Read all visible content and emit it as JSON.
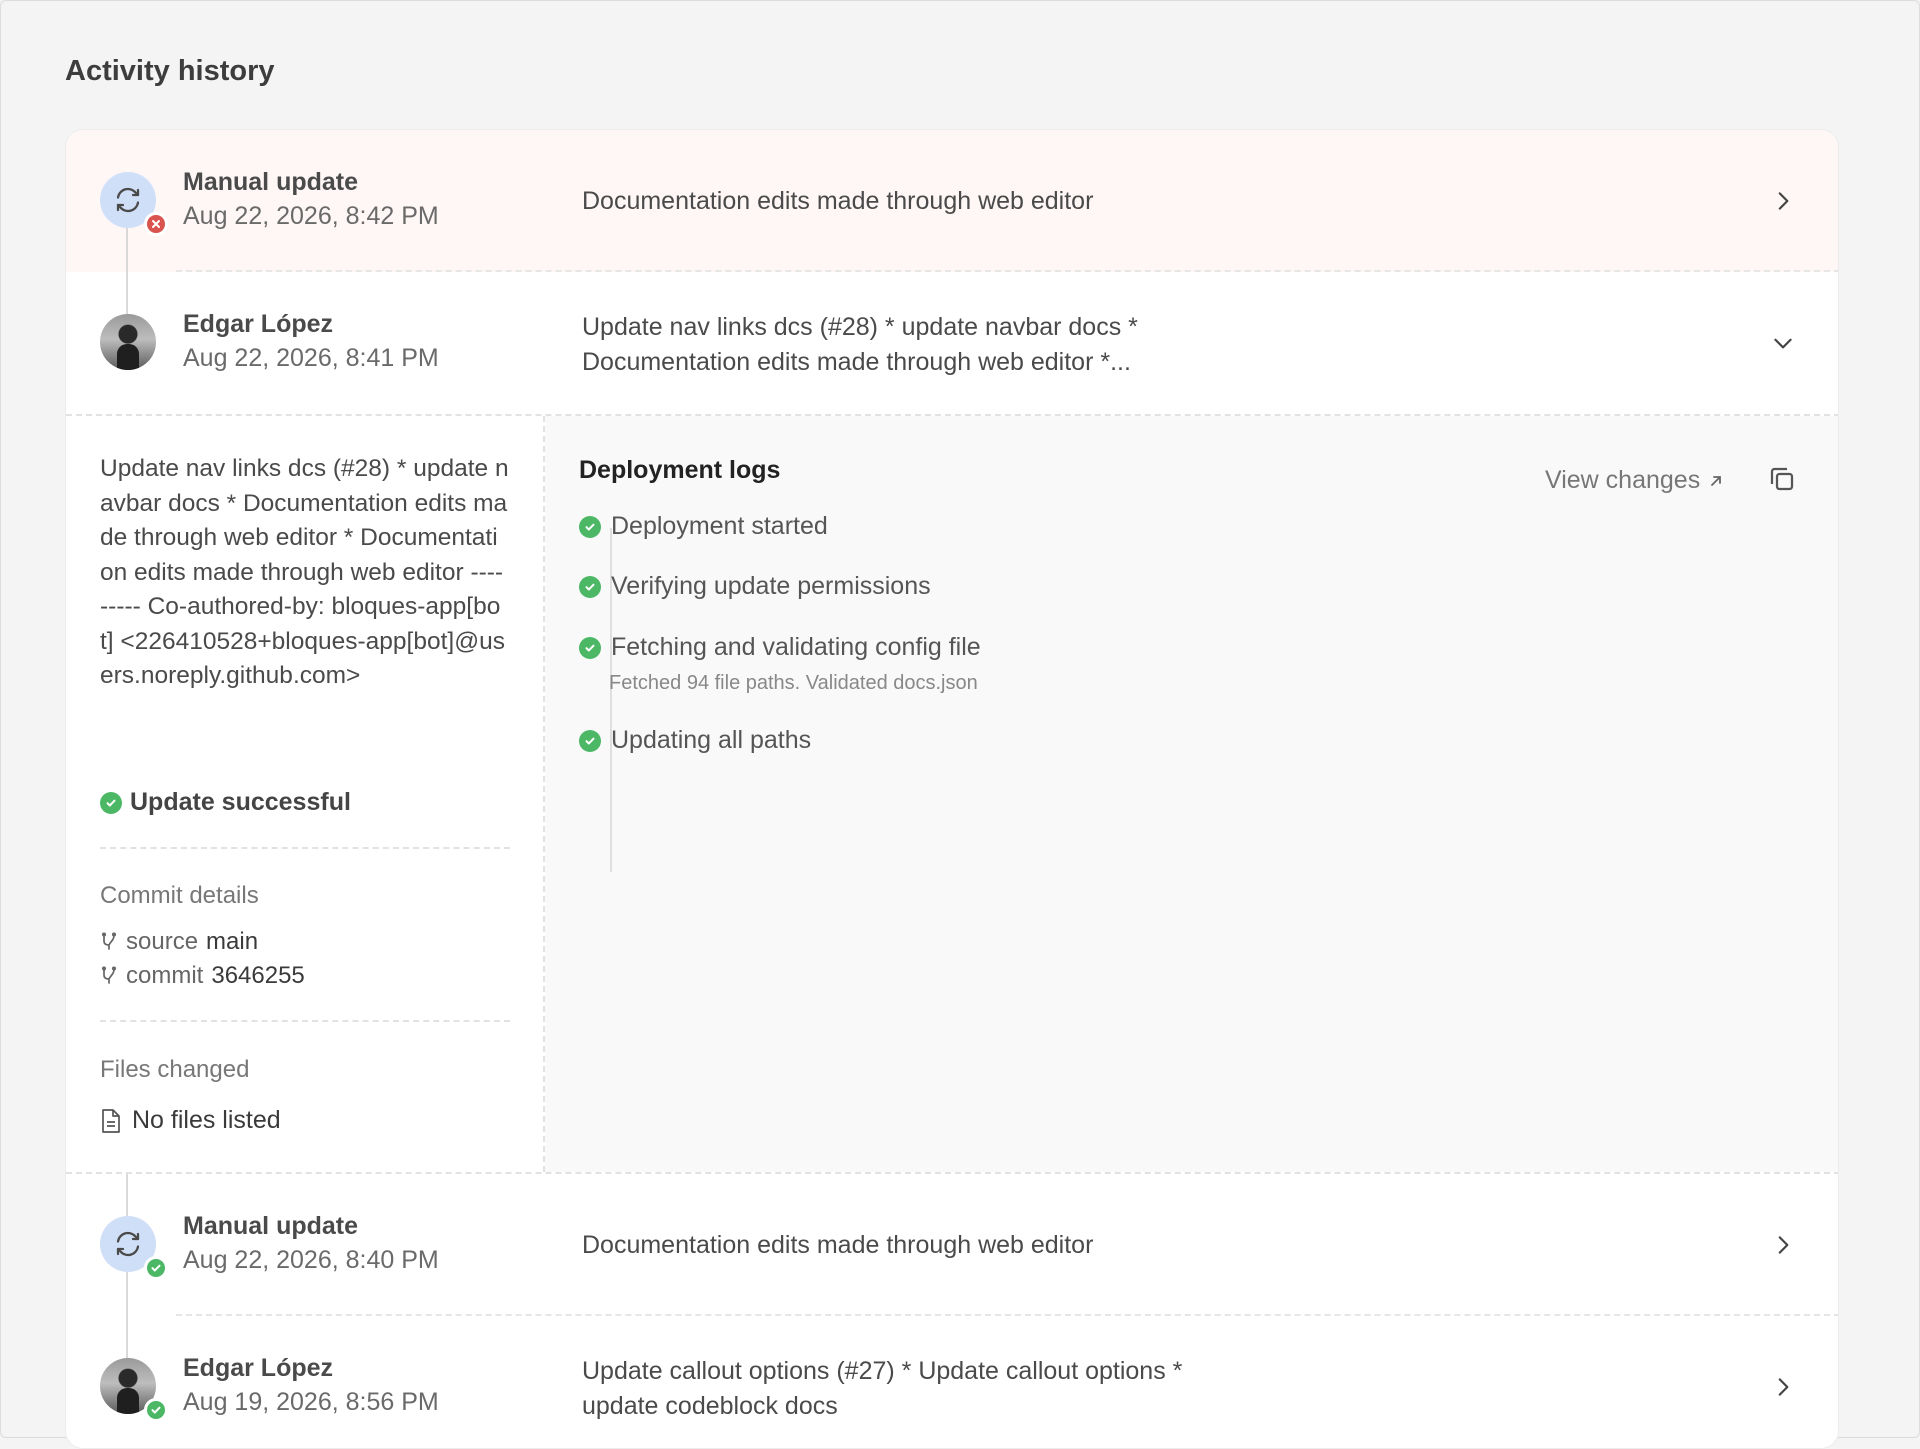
{
  "page": {
    "title": "Activity history"
  },
  "rows": [
    {
      "name": "Manual update",
      "date": "Aug 22, 2026, 8:42 PM",
      "description": "Documentation edits made through web editor",
      "status": "failed"
    },
    {
      "name": "Edgar López",
      "date": "Aug 22, 2026, 8:41 PM",
      "description_line1": "Update nav links dcs (#28) * update navbar docs *",
      "description_line2": "Documentation edits made through web editor *...",
      "status": "expanded"
    },
    {
      "name": "Manual update",
      "date": "Aug 22, 2026, 8:40 PM",
      "description": "Documentation edits made through web editor",
      "status": "success"
    },
    {
      "name": "Edgar López",
      "date": "Aug 19, 2026, 8:56 PM",
      "description_line1": "Update callout options (#27) * Update callout options *",
      "description_line2": "update codeblock docs",
      "status": "success"
    }
  ],
  "details": {
    "commit_message": "Update nav links dcs (#28) * update navbar docs * Documentation edits made through web editor * Documentation edits made through web editor --------- Co-authored-by: bloques-app[bot] <226410528+bloques-app[bot]@users.noreply.github.com>",
    "status": "Update successful",
    "commit_details_label": "Commit details",
    "source_label": "source",
    "source_value": "main",
    "commit_label": "commit",
    "commit_value": "3646255",
    "files_changed_label": "Files changed",
    "files_value": "No files listed",
    "logs_title": "Deployment logs",
    "view_changes": "View changes",
    "logs": [
      {
        "text": "Deployment started"
      },
      {
        "text": "Verifying update permissions"
      },
      {
        "text": "Fetching and validating config file",
        "sub": "Fetched 94 file paths. Validated docs.json"
      },
      {
        "text": "Updating all paths"
      }
    ]
  },
  "colors": {
    "error": "#d9534f",
    "success": "#4cb865",
    "sync_bg": "#cfdff7",
    "failed_row_bg": "#fff6f6"
  },
  "icons": [
    "sync-icon",
    "error-badge-icon",
    "success-badge-icon",
    "chevron-right-icon",
    "chevron-down-icon",
    "external-link-icon",
    "copy-icon",
    "branch-icon",
    "file-icon",
    "check-icon"
  ]
}
